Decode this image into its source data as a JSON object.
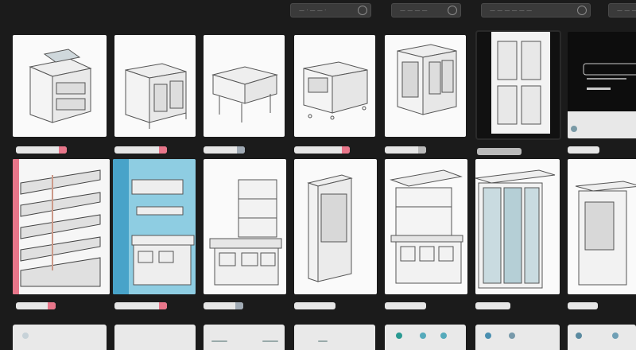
{
  "toolbar": {
    "fields": [
      {
        "label": "— · — — ·"
      },
      {
        "label": "— — — —"
      },
      {
        "label": "— — — — — —"
      },
      {
        "label": "— — — —"
      }
    ]
  },
  "accent": "#e0566e",
  "grid": {
    "row1": [
      {
        "name": "cabinet-result-1"
      },
      {
        "name": "cabinet-result-2"
      },
      {
        "name": "cabinet-result-3"
      },
      {
        "name": "cabinet-result-4"
      },
      {
        "name": "cabinet-result-5"
      },
      {
        "name": "cabinet-result-6"
      },
      {
        "name": "cabinet-result-7"
      }
    ],
    "row2": [
      {
        "name": "cabinet-result-8"
      },
      {
        "name": "cabinet-result-9"
      },
      {
        "name": "cabinet-result-10"
      },
      {
        "name": "cabinet-result-11"
      },
      {
        "name": "cabinet-result-12"
      },
      {
        "name": "cabinet-result-13"
      },
      {
        "name": "cabinet-result-14"
      }
    ]
  }
}
